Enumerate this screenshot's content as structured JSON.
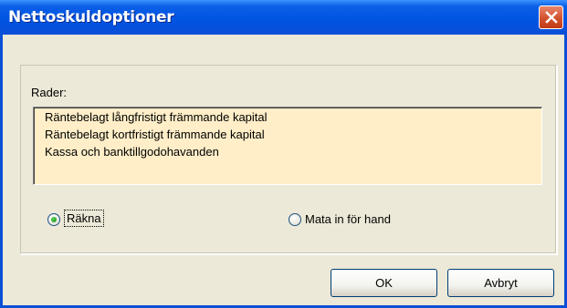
{
  "window": {
    "title": "Nettoskuldoptioner",
    "close_icon": "close-icon"
  },
  "rows": {
    "label": "Rader:",
    "items": [
      "Räntebelagt långfristigt främmande kapital",
      "Räntebelagt kortfristigt främmande kapital",
      "Kassa och banktillgodohavanden"
    ],
    "background": "#ffeec8"
  },
  "options": {
    "count": {
      "label": "Räkna",
      "selected": true
    },
    "manual": {
      "label": "Mata in för hand",
      "selected": false
    }
  },
  "buttons": {
    "ok": "OK",
    "cancel": "Avbryt"
  },
  "colors": {
    "titlebar": "#0054e3",
    "dialog": "#ece9d8",
    "close": "#d2512f"
  }
}
